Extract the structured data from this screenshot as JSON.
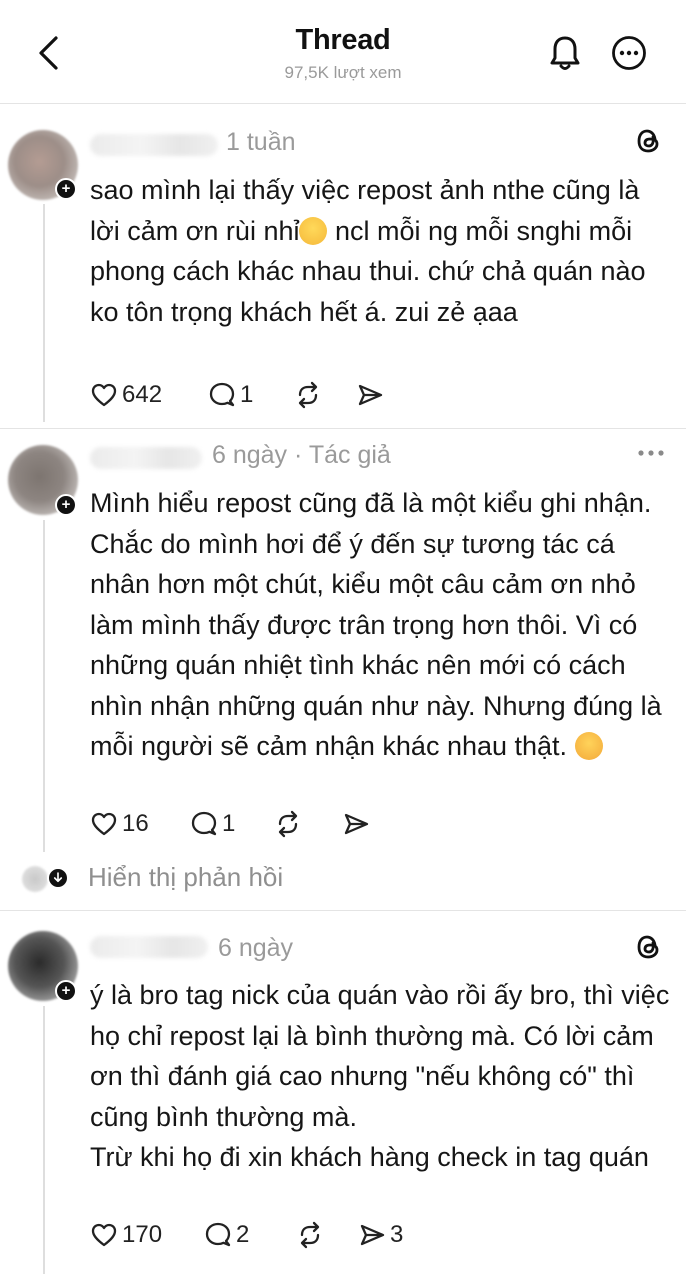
{
  "header": {
    "title": "Thread",
    "views": "97,5K lượt xem"
  },
  "posts": [
    {
      "time": "1 tuần",
      "text_before_emoji": "sao mình lại thấy việc repost ảnh nthe cũng là lời cảm ơn rùi nhỉ",
      "emoji": "🥹",
      "text_after_emoji": " ncl mỗi ng mỗi snghi mỗi phong cách khác nhau thui. chứ chả quán nào ko tôn trọng khách hết á. zui zẻ ạaa",
      "likes": "642",
      "replies": "1",
      "reposts": "",
      "shares": ""
    },
    {
      "time": "6 ngày · Tác giả",
      "text": "Mình hiểu repost cũng đã là một kiểu ghi nhận. Chắc do mình hơi để ý đến sự tương tác cá nhân hơn một chút, kiểu một câu cảm ơn nhỏ làm mình thấy được trân trọng hơn thôi. Vì có những quán nhiệt tình khác nên mới có cách nhìn nhận những quán như này.  Nhưng đúng là mỗi người sẽ cảm nhận khác nhau thật.",
      "emoji": "😊",
      "likes": "16",
      "replies": "1",
      "reposts": "",
      "shares": ""
    },
    {
      "time": "6 ngày",
      "text": "ý là bro tag nick của quán vào rồi ấy bro, thì việc họ chỉ repost lại là bình thường mà. Có lời cảm ơn thì đánh giá cao nhưng \"nếu không có\" thì cũng bình thường mà.\nTrừ khi họ đi xin khách hàng check in tag quán",
      "likes": "170",
      "replies": "2",
      "reposts": "",
      "shares": "3"
    }
  ],
  "show_replies": "Hiển thị phản hồi",
  "icons": {
    "back": "chevron-left-icon",
    "bell": "bell-icon",
    "more": "more-circle-icon",
    "threads": "threads-logo-icon",
    "like": "heart-icon",
    "reply": "comment-icon",
    "repost": "repost-icon",
    "share": "send-icon"
  }
}
